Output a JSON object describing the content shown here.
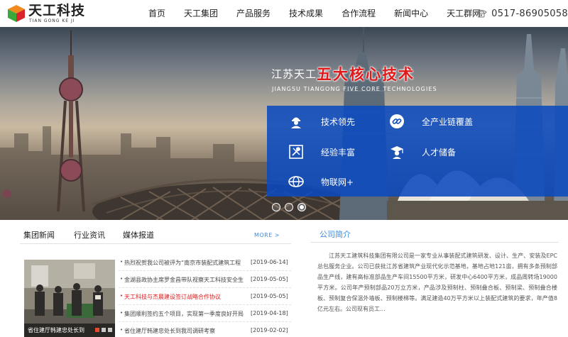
{
  "header": {
    "logo_title": "天工科技",
    "logo_sub": "TIAN GONG KE JI",
    "nav": [
      "首页",
      "天工集团",
      "产品服务",
      "技术成果",
      "合作流程",
      "新闻中心",
      "天工群网"
    ],
    "phone": "0517-86905058"
  },
  "banner": {
    "headline_prefix": "江苏天工",
    "headline_main": "五大核心技术",
    "subline": "JIANGSU TIANGONG FIVE CORE TECHNOLOGIES",
    "features": [
      {
        "label": "技术领先",
        "icon": "worker-icon"
      },
      {
        "label": "全产业链覆盖",
        "icon": "chain-link-icon"
      },
      {
        "label": "经验丰富",
        "icon": "tools-icon"
      },
      {
        "label": "人才储备",
        "icon": "graduate-icon"
      },
      {
        "label": "物联网+",
        "icon": "globe-icon"
      }
    ],
    "slide_count": 3,
    "active_slide": 3
  },
  "news": {
    "tabs": [
      "集团新闻",
      "行业资讯",
      "媒体报道"
    ],
    "more": "MORE >",
    "photo_caption": "省住建厅韩建忠处长到",
    "photo_slide_count": 3,
    "photo_active_slide": 1,
    "items": [
      {
        "title": "热烈祝贺我公司被评为“南京市装配式建筑工程",
        "date": "[2019-06-14]",
        "highlight": false
      },
      {
        "title": "金湖县政协主席罗金昌带队视察天工科技安全生",
        "date": "[2019-05-05]",
        "highlight": false
      },
      {
        "title": "天工科技与杰晨建设签订战略合作协议",
        "date": "[2019-05-05]",
        "highlight": true
      },
      {
        "title": "集团顺利签约五个项目，实现第一季度良好开局",
        "date": "[2019-04-18]",
        "highlight": false
      },
      {
        "title": "省住建厅韩建忠处长到我司调研考察",
        "date": "[2019-02-02]",
        "highlight": false
      }
    ]
  },
  "profile": {
    "title": "公司简介",
    "body": "江苏天工建筑科技集团有限公司是一家专业从事装配式建筑研发、设计、生产、安装及EPC总包服务企业。公司已获批江苏省建筑产业现代化示范基地，基地占地121亩，拥有多条预制部品生产线，建有高标准部品生产车间15500平方米，研发中心6400平方米，成品周转场19000平方米。公司年产预制部品20万立方米，产品涉及预制柱、预制叠合板、预制梁、预制叠合楼板、预制复合保温外墙板、预制楼梯等。满足建造40万平方米以上装配式建筑的要求，年产值8亿元左右。公司现有员工..."
  },
  "colors": {
    "accent_blue": "#0b4abe",
    "headline_red": "#e0191b",
    "link_blue": "#3a8de0"
  }
}
